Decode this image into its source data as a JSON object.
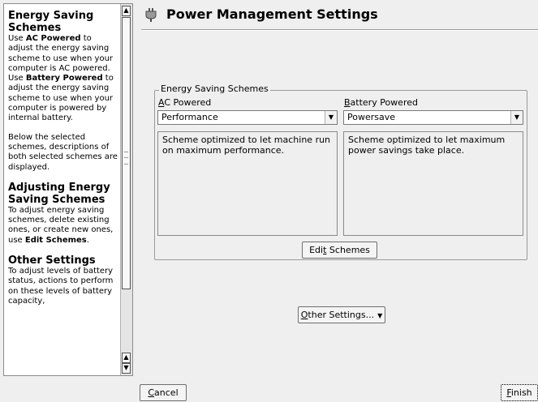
{
  "help": {
    "sections": [
      {
        "heading": "Energy Saving Schemes",
        "paragraphs": [
          [
            "Use ",
            {
              "b": "AC Powered"
            },
            " to adjust the energy saving scheme to use when your computer is AC powered. Use ",
            {
              "b": "Battery Powered"
            },
            " to adjust the energy saving scheme to use when your computer is powered by internal battery."
          ],
          [
            "Below the selected schemes, descriptions of both selected schemes are displayed."
          ]
        ]
      },
      {
        "heading": "Adjusting Energy Saving Schemes",
        "paragraphs": [
          [
            "To adjust energy saving schemes, delete existing ones, or create new ones, use ",
            {
              "b": "Edit Schemes"
            },
            "."
          ]
        ]
      },
      {
        "heading": "Other Settings",
        "paragraphs": [
          [
            "To adjust levels of battery status, actions to perform on these levels of battery capacity,"
          ]
        ]
      }
    ]
  },
  "main": {
    "title": "Power Management Settings",
    "group_title": "Energy Saving Schemes",
    "ac": {
      "label_accel": "A",
      "label_rest": "C Powered",
      "selected": "Performance",
      "description": "Scheme optimized to let machine run on maximum performance."
    },
    "battery": {
      "label_accel": "B",
      "label_rest": "attery Powered",
      "selected": "Powersave",
      "description": "Scheme optimized to let maximum power savings take place."
    },
    "edit_schemes": {
      "pre": "Edi",
      "accel": "t",
      "post": " Schemes"
    },
    "other_settings": {
      "accel": "O",
      "post": "ther Settings..."
    }
  },
  "footer": {
    "cancel": {
      "accel": "C",
      "post": "ancel"
    },
    "finish": {
      "accel": "F",
      "post": "inish"
    }
  },
  "icons": {
    "title": "power-plug-icon",
    "dropdown": "chevron-down-icon",
    "scroll_up": "arrow-up-icon",
    "scroll_down": "arrow-down-icon"
  }
}
